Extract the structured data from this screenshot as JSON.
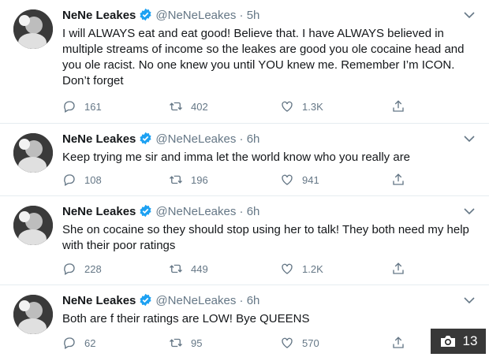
{
  "author": {
    "name": "NeNe Leakes",
    "handle": "@NeNeLeakes"
  },
  "separator": "·",
  "tweets": [
    {
      "time": "5h",
      "text": "I will ALWAYS eat and eat good! Believe that. I have ALWAYS believed in multiple streams of income so the leakes are good you ole cocaine head and you ole racist. No one knew you until YOU knew me. Remember I’m ICON. Don’t forget",
      "replies": "161",
      "retweets": "402",
      "likes": "1.3K"
    },
    {
      "time": "6h",
      "text": "Keep trying me sir and imma let the world know who you really are",
      "replies": "108",
      "retweets": "196",
      "likes": "941"
    },
    {
      "time": "6h",
      "text": "She on cocaine so they should stop using her to talk! They both need my help with their poor ratings",
      "replies": "228",
      "retweets": "449",
      "likes": "1.2K"
    },
    {
      "time": "6h",
      "text": "Both are f their ratings are LOW! Bye QUEENS",
      "replies": "62",
      "retweets": "95",
      "likes": "570"
    }
  ],
  "photo_count": "13",
  "icons": {
    "verified": "verified-badge-icon",
    "reply": "reply-icon",
    "retweet": "retweet-icon",
    "like": "heart-icon",
    "share": "share-icon",
    "caret": "chevron-down-icon",
    "camera": "camera-icon"
  },
  "colors": {
    "verified": "#1da1f2",
    "muted": "#657786",
    "divider": "#e6ecf0"
  }
}
